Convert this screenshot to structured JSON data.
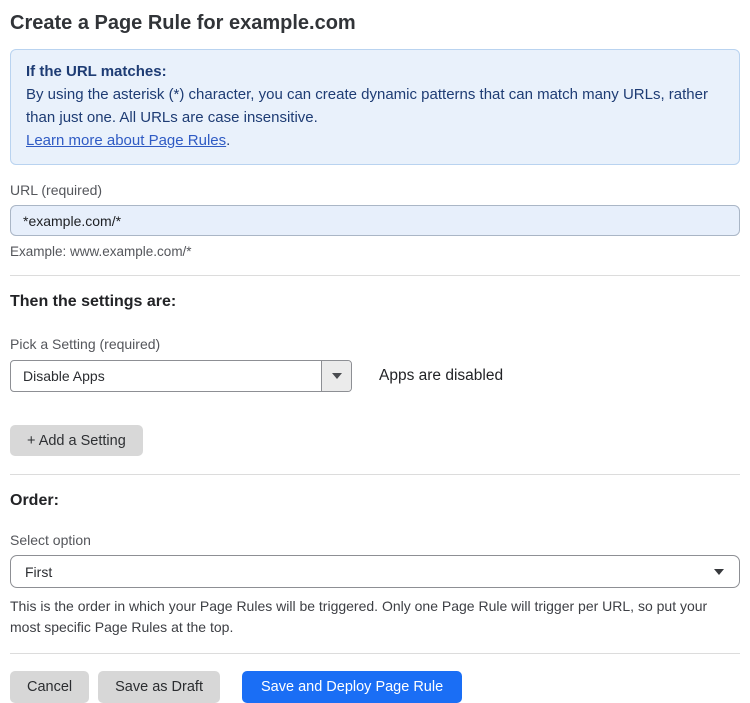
{
  "page": {
    "title": "Create a Page Rule for example.com"
  },
  "info_box": {
    "heading": "If the URL matches:",
    "body": "By using the asterisk (*) character, you can create dynamic patterns that can match many URLs, rather than just one. All URLs are case insensitive.",
    "link_label": "Learn more about Page Rules",
    "link_suffix": "."
  },
  "url_field": {
    "label": "URL (required)",
    "value": "*example.com/*",
    "helper": "Example: www.example.com/*"
  },
  "settings_section": {
    "heading": "Then the settings are:",
    "setting_label": "Pick a Setting (required)",
    "setting_value": "Disable Apps",
    "setting_status": "Apps are disabled",
    "add_setting_label": "+ Add a Setting"
  },
  "order_section": {
    "heading": "Order:",
    "label": "Select option",
    "value": "First",
    "description": "This is the order in which your Page Rules will be triggered. Only one Page Rule will trigger per URL, so put your most specific Page Rules at the top."
  },
  "actions": {
    "cancel_label": "Cancel",
    "save_draft_label": "Save as Draft",
    "save_deploy_label": "Save and Deploy Page Rule"
  },
  "icons": {
    "setting_dropdown": "dropdown-arrow-icon",
    "order_dropdown": "dropdown-caret-icon"
  },
  "colors": {
    "info_bg": "#e9f1fb",
    "info_border": "#b9d3f0",
    "info_text": "#1e3c74",
    "link": "#2f5bc4",
    "input_bg": "#e7effb",
    "primary_button": "#1a6ef5"
  }
}
